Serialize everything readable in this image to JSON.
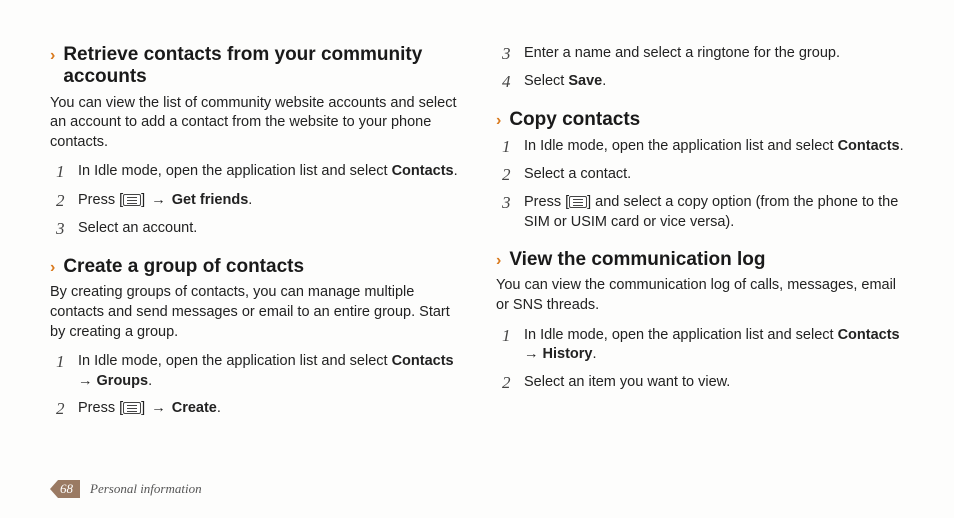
{
  "left": {
    "s1": {
      "title": "Retrieve contacts from your community accounts",
      "intro": "You can view the list of community website accounts and select an account to add a contact from the website to your phone contacts.",
      "steps": {
        "n1": "1",
        "t1a": "In Idle mode, open the application list and select ",
        "t1b": "Contacts",
        "t1c": ".",
        "n2": "2",
        "t2a": "Press [",
        "t2b": "] ",
        "t2arrow": "→",
        "t2c": " Get friends",
        "t2d": ".",
        "n3": "3",
        "t3": "Select an account."
      }
    },
    "s2": {
      "title": "Create a group of contacts",
      "intro": "By creating groups of contacts, you can manage multiple contacts and send messages or email to an entire group. Start by creating a group.",
      "steps": {
        "n1": "1",
        "t1a": "In Idle mode, open the application list and select ",
        "t1b": "Contacts",
        "t1arrow": " → ",
        "t1c": "Groups",
        "t1d": ".",
        "n2": "2",
        "t2a": "Press [",
        "t2b": "] ",
        "t2arrow": "→",
        "t2c": " Create",
        "t2d": "."
      }
    }
  },
  "right": {
    "topsteps": {
      "n3": "3",
      "t3": "Enter a name and select a ringtone for the group.",
      "n4": "4",
      "t4a": "Select ",
      "t4b": "Save",
      "t4c": "."
    },
    "s3": {
      "title": "Copy contacts",
      "steps": {
        "n1": "1",
        "t1a": "In Idle mode, open the application list and select ",
        "t1b": "Contacts",
        "t1c": ".",
        "n2": "2",
        "t2": "Select a contact.",
        "n3": "3",
        "t3a": "Press [",
        "t3b": "] and select a copy option (from the phone to the SIM or USIM card or vice versa)."
      }
    },
    "s4": {
      "title": "View the communication log",
      "intro": "You can view the communication log of calls, messages, email or SNS threads.",
      "steps": {
        "n1": "1",
        "t1a": "In Idle mode, open the application list and select ",
        "t1b": "Contacts",
        "t1arrow": " → ",
        "t1c": "History",
        "t1d": ".",
        "n2": "2",
        "t2": "Select an item you want to view."
      }
    }
  },
  "footer": {
    "page": "68",
    "label": "Personal information"
  },
  "chevron": "›"
}
